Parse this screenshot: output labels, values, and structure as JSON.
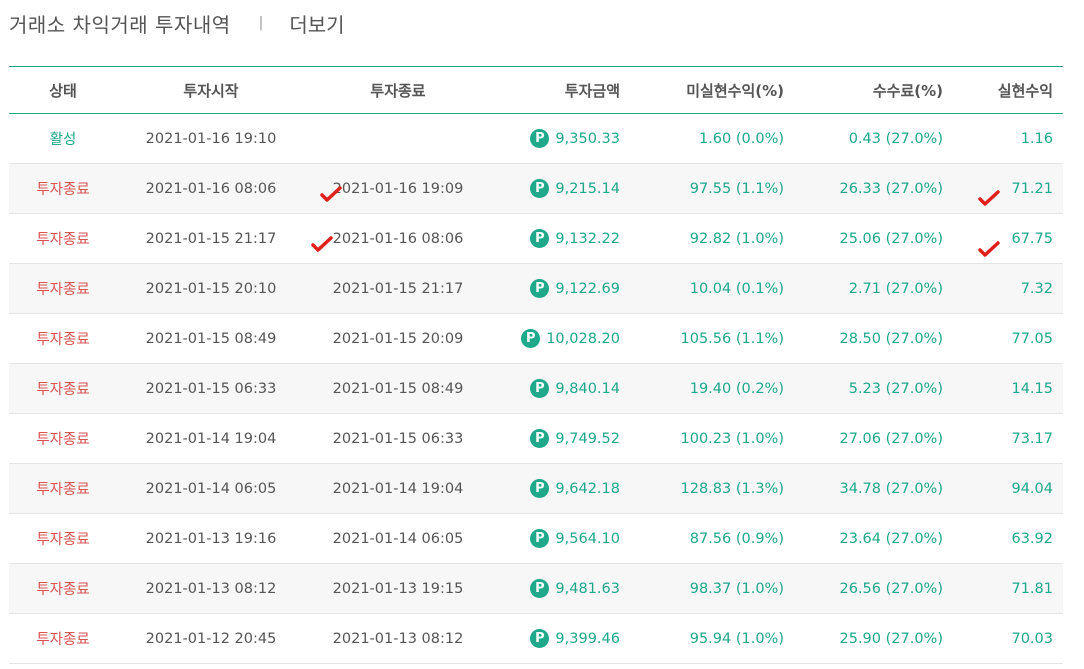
{
  "header": {
    "title": "거래소 차익거래 투자내역",
    "separator": "|",
    "more_label": "더보기"
  },
  "columns": {
    "status": "상태",
    "start": "투자시작",
    "end": "투자종료",
    "amount": "투자금액",
    "unrealized": "미실현수익(%)",
    "fee": "수수료(%)",
    "realized": "실현수익"
  },
  "point_icon": "p-point-icon",
  "rows": [
    {
      "status": "활성",
      "start": "2021-01-16 19:10",
      "end": "",
      "amount": "9,350.33",
      "unrealized": "1.60 (0.0%)",
      "fee": "0.43 (27.0%)",
      "realized": "1.16"
    },
    {
      "status": "투자종료",
      "start": "2021-01-16 08:06",
      "end": "2021-01-16 19:09",
      "amount": "9,215.14",
      "unrealized": "97.55 (1.1%)",
      "fee": "26.33 (27.0%)",
      "realized": "71.21"
    },
    {
      "status": "투자종료",
      "start": "2021-01-15 21:17",
      "end": "2021-01-16 08:06",
      "amount": "9,132.22",
      "unrealized": "92.82 (1.0%)",
      "fee": "25.06 (27.0%)",
      "realized": "67.75"
    },
    {
      "status": "투자종료",
      "start": "2021-01-15 20:10",
      "end": "2021-01-15 21:17",
      "amount": "9,122.69",
      "unrealized": "10.04 (0.1%)",
      "fee": "2.71 (27.0%)",
      "realized": "7.32"
    },
    {
      "status": "투자종료",
      "start": "2021-01-15 08:49",
      "end": "2021-01-15 20:09",
      "amount": "10,028.20",
      "unrealized": "105.56 (1.1%)",
      "fee": "28.50 (27.0%)",
      "realized": "77.05"
    },
    {
      "status": "투자종료",
      "start": "2021-01-15 06:33",
      "end": "2021-01-15 08:49",
      "amount": "9,840.14",
      "unrealized": "19.40 (0.2%)",
      "fee": "5.23 (27.0%)",
      "realized": "14.15"
    },
    {
      "status": "투자종료",
      "start": "2021-01-14 19:04",
      "end": "2021-01-15 06:33",
      "amount": "9,749.52",
      "unrealized": "100.23 (1.0%)",
      "fee": "27.06 (27.0%)",
      "realized": "73.17"
    },
    {
      "status": "투자종료",
      "start": "2021-01-14 06:05",
      "end": "2021-01-14 19:04",
      "amount": "9,642.18",
      "unrealized": "128.83 (1.3%)",
      "fee": "34.78 (27.0%)",
      "realized": "94.04"
    },
    {
      "status": "투자종료",
      "start": "2021-01-13 19:16",
      "end": "2021-01-14 06:05",
      "amount": "9,564.10",
      "unrealized": "87.56 (0.9%)",
      "fee": "23.64 (27.0%)",
      "realized": "63.92"
    },
    {
      "status": "투자종료",
      "start": "2021-01-13 08:12",
      "end": "2021-01-13 19:15",
      "amount": "9,481.63",
      "unrealized": "98.37 (1.0%)",
      "fee": "26.56 (27.0%)",
      "realized": "71.81"
    },
    {
      "status": "투자종료",
      "start": "2021-01-12 20:45",
      "end": "2021-01-13 08:12",
      "amount": "9,399.46",
      "unrealized": "95.94 (1.0%)",
      "fee": "25.90 (27.0%)",
      "realized": "70.03"
    }
  ],
  "colors": {
    "accent": "#1fa88a",
    "closed": "#d9534f",
    "check": "#e0211b"
  }
}
